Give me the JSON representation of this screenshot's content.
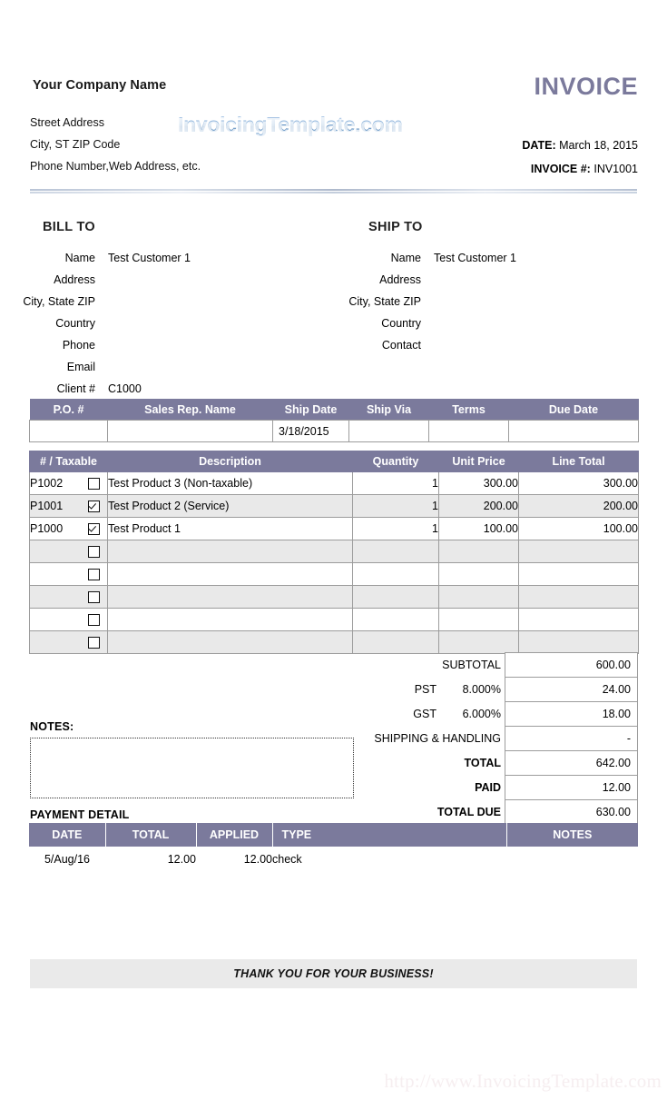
{
  "header": {
    "company_name": "Your Company Name",
    "invoice_title": "INVOICE",
    "address_lines": [
      "Street Address",
      "City, ST  ZIP Code",
      "Phone Number,Web Address, etc."
    ],
    "logo_text": "InvoicingTemplate.com",
    "date_label": "DATE:",
    "date_value": "March 18, 2015",
    "invoice_no_label": "INVOICE #:",
    "invoice_no_value": "INV1001"
  },
  "bill_to": {
    "title": "BILL TO",
    "rows": [
      {
        "label": "Name",
        "value": "Test Customer 1"
      },
      {
        "label": "Address",
        "value": ""
      },
      {
        "label": "City, State ZIP",
        "value": ""
      },
      {
        "label": "Country",
        "value": ""
      },
      {
        "label": "Phone",
        "value": ""
      },
      {
        "label": "Email",
        "value": ""
      },
      {
        "label": "Client #",
        "value": "C1000"
      }
    ]
  },
  "ship_to": {
    "title": "SHIP TO",
    "rows": [
      {
        "label": "Name",
        "value": "Test Customer 1"
      },
      {
        "label": "Address",
        "value": ""
      },
      {
        "label": "City, State ZIP",
        "value": ""
      },
      {
        "label": "Country",
        "value": ""
      },
      {
        "label": "Contact",
        "value": ""
      }
    ]
  },
  "po_table": {
    "headers": [
      "P.O. #",
      "Sales Rep. Name",
      "Ship Date",
      "Ship Via",
      "Terms",
      "Due Date"
    ],
    "row": {
      "po_number": "",
      "sales_rep": "",
      "ship_date": "3/18/2015",
      "ship_via": "",
      "terms": "",
      "due_date": ""
    }
  },
  "items_table": {
    "headers": [
      "# / Taxable",
      "Description",
      "Quantity",
      "Unit Price",
      "Line Total"
    ],
    "rows": [
      {
        "number": "P1002",
        "taxable": false,
        "description": "Test Product 3 (Non-taxable)",
        "quantity": "1",
        "unit_price": "300.00",
        "line_total": "300.00"
      },
      {
        "number": "P1001",
        "taxable": true,
        "description": "Test Product 2 (Service)",
        "quantity": "1",
        "unit_price": "200.00",
        "line_total": "200.00"
      },
      {
        "number": "P1000",
        "taxable": true,
        "description": "Test Product 1",
        "quantity": "1",
        "unit_price": "100.00",
        "line_total": "100.00"
      },
      {
        "number": "",
        "taxable": false,
        "description": "",
        "quantity": "",
        "unit_price": "",
        "line_total": ""
      },
      {
        "number": "",
        "taxable": false,
        "description": "",
        "quantity": "",
        "unit_price": "",
        "line_total": ""
      },
      {
        "number": "",
        "taxable": false,
        "description": "",
        "quantity": "",
        "unit_price": "",
        "line_total": ""
      },
      {
        "number": "",
        "taxable": false,
        "description": "",
        "quantity": "",
        "unit_price": "",
        "line_total": ""
      },
      {
        "number": "",
        "taxable": false,
        "description": "",
        "quantity": "",
        "unit_price": "",
        "line_total": ""
      }
    ]
  },
  "totals": [
    {
      "label": "SUBTOTAL",
      "rate": "",
      "value": "600.00",
      "bold": false
    },
    {
      "label": "PST",
      "rate": "8.000%",
      "value": "24.00",
      "bold": false
    },
    {
      "label": "GST",
      "rate": "6.000%",
      "value": "18.00",
      "bold": false
    },
    {
      "label": "SHIPPING & HANDLING",
      "rate": "",
      "value": "-",
      "bold": false
    },
    {
      "label": "TOTAL",
      "rate": "",
      "value": "642.00",
      "bold": true
    },
    {
      "label": "PAID",
      "rate": "",
      "value": "12.00",
      "bold": true
    },
    {
      "label": "TOTAL DUE",
      "rate": "",
      "value": "630.00",
      "bold": true
    }
  ],
  "notes": {
    "label": "NOTES:",
    "value": ""
  },
  "payment_detail": {
    "label": "PAYMENT DETAIL",
    "headers": [
      "DATE",
      "TOTAL",
      "APPLIED",
      "TYPE",
      "NOTES"
    ],
    "rows": [
      {
        "date": "5/Aug/16",
        "total": "12.00",
        "applied": "12.00",
        "type": "check",
        "notes": ""
      }
    ]
  },
  "footer": {
    "thank_you": "THANK YOU FOR YOUR BUSINESS!",
    "watermark": "http://www.InvoicingTemplate.com"
  },
  "colors": {
    "header_purple": "#7b7a9c",
    "zebra_gray": "#e9e9e9",
    "footer_gray": "#eaeaea",
    "border_gray": "#9c9c9c",
    "logo_blue": "#4a7fb5"
  }
}
